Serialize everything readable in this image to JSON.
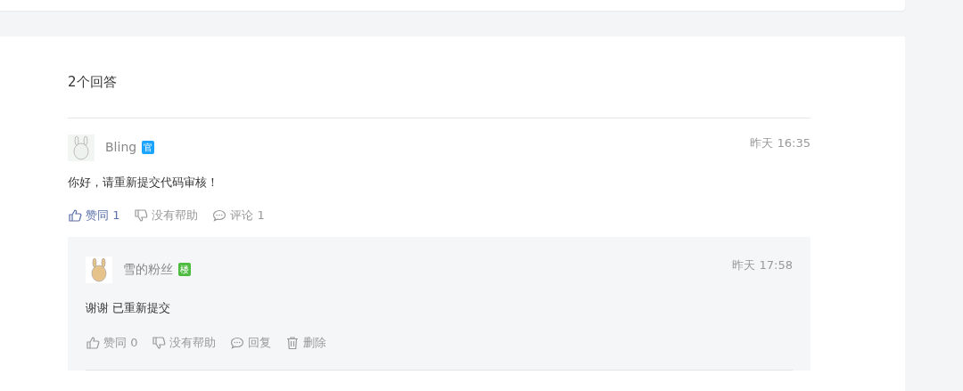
{
  "answers_heading": "2个回答",
  "answers": [
    {
      "author": "Bling",
      "badge": {
        "text": "官",
        "color": "#1aa3ff"
      },
      "time": "昨天 16:35",
      "content": "你好，请重新提交代码审核！",
      "actions": [
        {
          "kind": "like",
          "label": "赞同 1",
          "selected": true
        },
        {
          "kind": "dislike",
          "label": "没有帮助",
          "selected": false
        },
        {
          "kind": "comment",
          "label": "评论 1",
          "selected": false
        }
      ],
      "replies": [
        {
          "author": "雪的粉丝",
          "badge": {
            "text": "楼",
            "color": "#4cbb3f"
          },
          "time": "昨天 17:58",
          "content": "谢谢 已重新提交",
          "actions": [
            {
              "kind": "like",
              "label": "赞同 0",
              "selected": false
            },
            {
              "kind": "dislike",
              "label": "没有帮助",
              "selected": false
            },
            {
              "kind": "comment",
              "label": "回复",
              "selected": false
            },
            {
              "kind": "delete",
              "label": "删除",
              "selected": false
            }
          ]
        }
      ]
    }
  ]
}
